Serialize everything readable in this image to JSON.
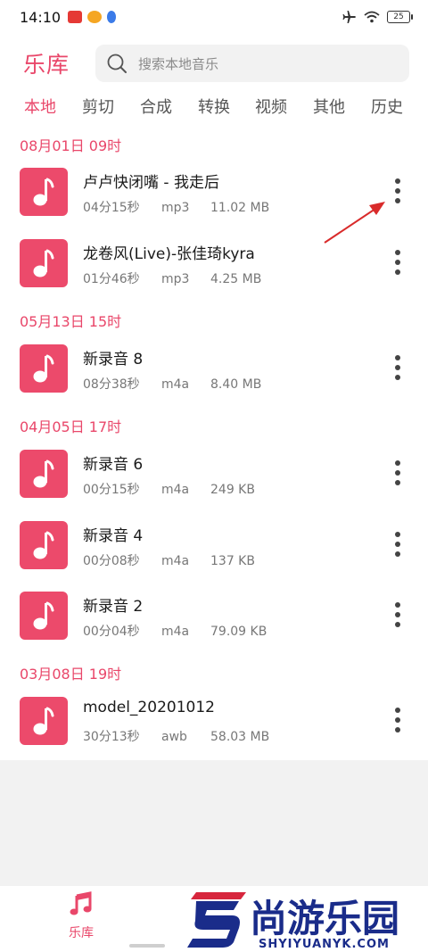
{
  "status_bar": {
    "time": "14:10",
    "battery": "25"
  },
  "header": {
    "title": "乐库",
    "search_placeholder": "搜索本地音乐"
  },
  "tabs": [
    {
      "label": "本地",
      "active": true
    },
    {
      "label": "剪切",
      "active": false
    },
    {
      "label": "合成",
      "active": false
    },
    {
      "label": "转换",
      "active": false
    },
    {
      "label": "视频",
      "active": false
    },
    {
      "label": "其他",
      "active": false
    },
    {
      "label": "历史",
      "active": false
    }
  ],
  "groups": [
    {
      "header": "08月01日  09时",
      "items": [
        {
          "title": "卢卢快闭嘴 - 我走后",
          "duration": "04分15秒",
          "format": "mp3",
          "size": "11.02 MB"
        },
        {
          "title": "龙卷风(Live)-张佳琦kyra",
          "duration": "01分46秒",
          "format": "mp3",
          "size": "4.25 MB"
        }
      ]
    },
    {
      "header": "05月13日  15时",
      "items": [
        {
          "title": "新录音 8",
          "duration": "08分38秒",
          "format": "m4a",
          "size": "8.40 MB"
        }
      ]
    },
    {
      "header": "04月05日  17时",
      "items": [
        {
          "title": "新录音 6",
          "duration": "00分15秒",
          "format": "m4a",
          "size": "249 KB"
        },
        {
          "title": "新录音 4",
          "duration": "00分08秒",
          "format": "m4a",
          "size": "137 KB"
        },
        {
          "title": "新录音 2",
          "duration": "00分04秒",
          "format": "m4a",
          "size": "79.09 KB"
        }
      ]
    },
    {
      "header": "03月08日  19时",
      "items": [
        {
          "title": "model_20201012",
          "duration": "30分13秒",
          "format": "awb",
          "size": "58.03 MB"
        }
      ]
    }
  ],
  "bottom_nav": {
    "library_label": "乐库"
  },
  "watermark": {
    "text": "尚游乐园",
    "domain": "SHYIYUANYK.COM"
  },
  "colors": {
    "accent": "#e9476a",
    "thumb": "#ec4a6b"
  }
}
